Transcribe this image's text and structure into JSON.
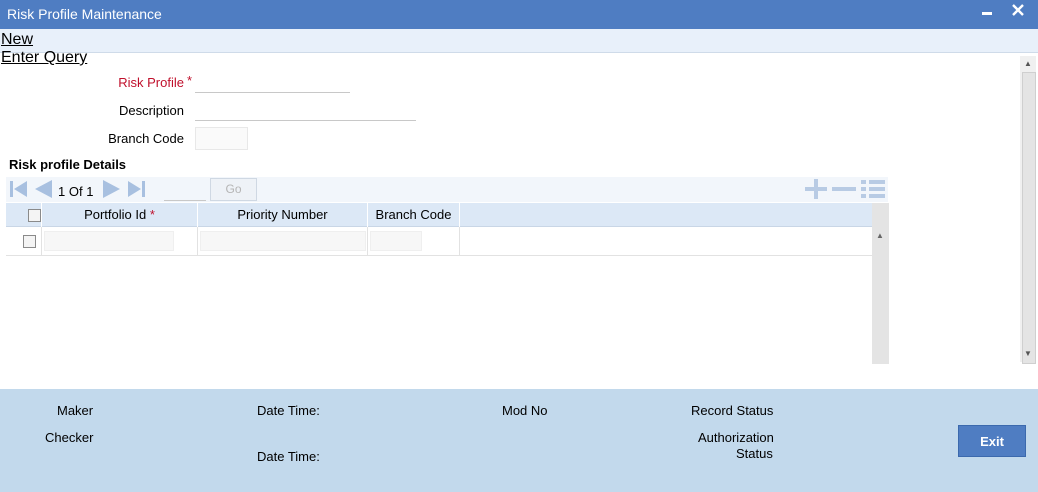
{
  "window": {
    "title": "Risk Profile Maintenance",
    "minimize_glyph": "▬",
    "close_glyph": "✕"
  },
  "menu": {
    "new_label": "New",
    "enter_query_label": "Enter Query"
  },
  "form": {
    "risk_profile_label": "Risk Profile",
    "risk_profile_required": "*",
    "risk_profile_value": "",
    "description_label": "Description",
    "description_value": "",
    "branch_code_label": "Branch Code",
    "branch_code_value": ""
  },
  "details": {
    "section_title": "Risk profile Details",
    "pager": {
      "current": "1",
      "of_label": "Of",
      "total": "1",
      "page_input_value": "",
      "go_label": "Go"
    },
    "icons": [
      "first-page-icon",
      "prev-page-icon",
      "next-page-icon",
      "last-page-icon",
      "add-row-icon",
      "delete-row-icon",
      "single-view-icon"
    ],
    "columns": [
      {
        "label": "Portfolio Id",
        "required": "*"
      },
      {
        "label": "Priority Number",
        "required": ""
      },
      {
        "label": "Branch Code",
        "required": ""
      }
    ],
    "rows": [
      {
        "portfolio_id": "",
        "priority_number": "",
        "branch_code": ""
      }
    ]
  },
  "footer": {
    "maker_label": "Maker",
    "checker_label": "Checker",
    "date_time_label_1": "Date Time:",
    "date_time_label_2": "Date Time:",
    "mod_no_label": "Mod No",
    "record_status_label": "Record Status",
    "authorization_label": "Authorization",
    "status_label": "Status",
    "exit_label": "Exit"
  },
  "colors": {
    "titlebar": "#4f7dc2",
    "required": "#c0102c",
    "footer": "#c2d9ec",
    "grid_header": "#dce8f6"
  }
}
